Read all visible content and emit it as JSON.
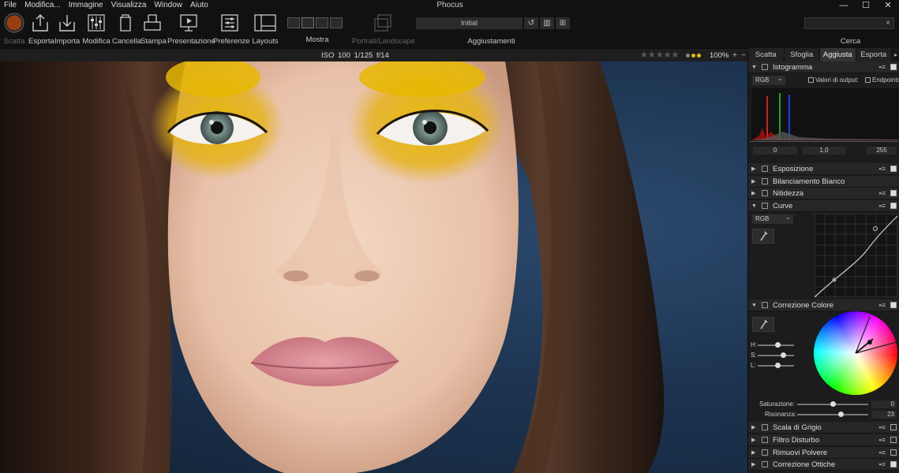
{
  "app_title": "Phocus",
  "menu": [
    "File",
    "Modifica...",
    "Immagine",
    "Visualizza",
    "Window",
    "Aiuto"
  ],
  "window_controls": [
    "—",
    "☐",
    "✕"
  ],
  "toolbar": {
    "scatta": "Scatta",
    "esporta": "Esporta",
    "importa": "Importa",
    "modifica": "Modifica",
    "cancella": "Cancella",
    "stampa": "Stampa",
    "presentazione": "Presentazione",
    "preferenze": "Preferenze",
    "layouts": "Layouts",
    "mostra": "Mostra",
    "portrait_landscape": "Portrait/Landscape",
    "preset_value": "Initial",
    "aggiustamenti": "Aggiustamenti",
    "cerca": "Cerca",
    "search_clear": "×"
  },
  "image_info": {
    "exif": "ISO 100  1/125  f/14",
    "rating_stars": "★★★★★",
    "zoom": "100%",
    "zoom_plus": "+",
    "zoom_minus": "−"
  },
  "colors": {
    "scatta_button": "#9a3f12",
    "tag_dots": [
      "#888888",
      "#e6c000",
      "#e6c000"
    ],
    "background_blue": "#1d3552"
  },
  "panel": {
    "tabs": [
      "Scatta",
      "Sfoglia",
      "Aggiusta",
      "Esporta"
    ],
    "active_tab": "Aggiusta",
    "tab_scroll": "▸",
    "sections": {
      "istogramma": "Istogramma",
      "esposizione": "Esposizione",
      "bilanciamento": "Bilanciamento Bianco",
      "nitidezza": "Nitidezza",
      "curve": "Curve",
      "correzione_colore": "Correzione Colore",
      "scala_grigio": "Scala di Grigio",
      "filtro_disturbo": "Filtro Disturbo",
      "rimuovi_polvere": "Rimuovi Polvere",
      "correzione_ottiche": "Correzione Ottiche"
    },
    "section_menu": "▪≡",
    "histogram": {
      "channel": "RGB",
      "valori_output": "Valori di output:",
      "endpoints": "Endpoints",
      "black": "0",
      "gamma": "1,0",
      "white": "255"
    },
    "curve": {
      "channel": "RGB"
    },
    "color_correction": {
      "h_label": "H:",
      "s_label": "S:",
      "l_label": "L:",
      "saturazione_label": "Saturazione:",
      "saturazione_value": "0",
      "risonanza_label": "Risonanza:",
      "risonanza_value": "23"
    }
  }
}
